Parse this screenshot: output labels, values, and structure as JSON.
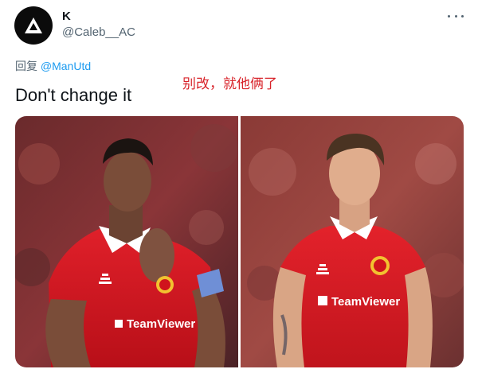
{
  "author": {
    "display_name": "K",
    "handle": "@Caleb__AC",
    "avatar_icon": "triangle-logo-icon"
  },
  "reply": {
    "prefix": "回复",
    "mention": "@ManUtd"
  },
  "tweet": {
    "text": "Don't change it"
  },
  "annotation": {
    "text": "别改，就他俩了",
    "color": "#d8232a"
  },
  "media": {
    "photos": [
      {
        "kit_sponsor": "TeamViewer",
        "kit_brand": "adidas"
      },
      {
        "kit_sponsor": "TeamViewer",
        "kit_brand": "adidas"
      }
    ]
  },
  "colors": {
    "handle": "#536471",
    "mention": "#1d9bf0",
    "kit_red": "#d0131c"
  }
}
